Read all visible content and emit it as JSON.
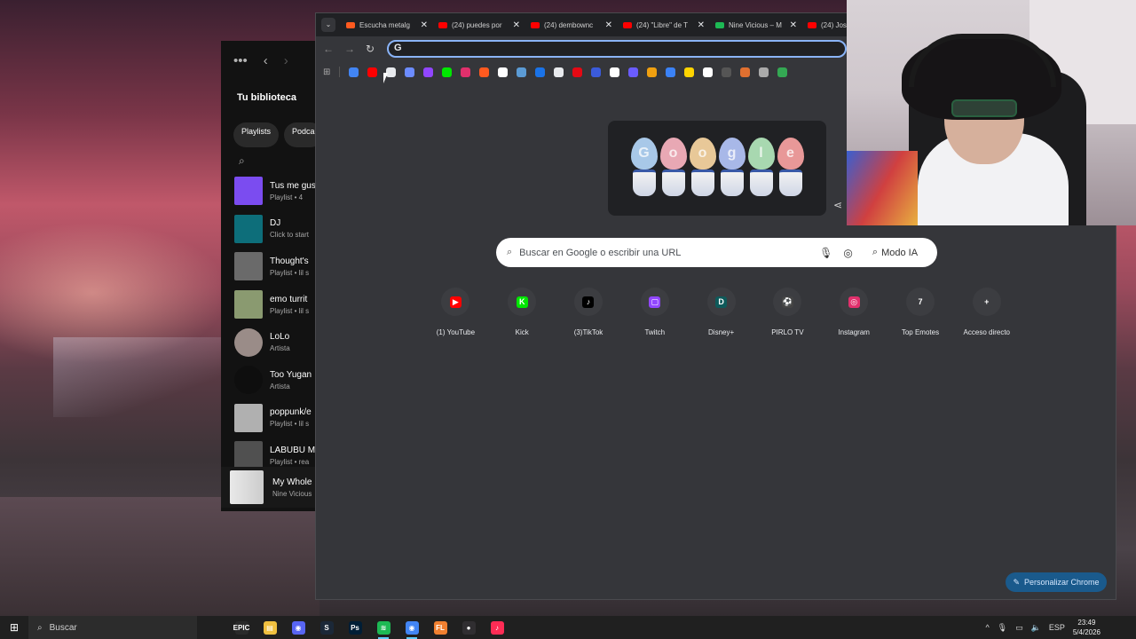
{
  "spotify": {
    "library_title": "Tu biblioteca",
    "chips": [
      "Playlists",
      "Podca"
    ],
    "items": [
      {
        "name": "Tus me gus",
        "sub": "Playlist • 4",
        "color": "#7b4cf0"
      },
      {
        "name": "DJ",
        "sub": "Click to start",
        "color": "#0d6e7a"
      },
      {
        "name": "Thought's",
        "sub": "Playlist • lil s",
        "color": "#6a6a6a"
      },
      {
        "name": "emo turrit",
        "sub": "Playlist • lil s",
        "color": "#8a9a70"
      },
      {
        "name": "LoLo",
        "sub": "Artista",
        "color": "#9a8c88"
      },
      {
        "name": "Too Yugan",
        "sub": "Artista",
        "color": "#0e0e0e"
      },
      {
        "name": "poppunk/e",
        "sub": "Playlist • lil s",
        "color": "#b0b0b0"
      },
      {
        "name": "LABUBU M",
        "sub": "Playlist • rea",
        "color": "#505050"
      }
    ],
    "now_playing": {
      "title": "My Whole H",
      "artist": "Nine Vicious"
    }
  },
  "chrome": {
    "tabs": [
      {
        "title": "Escucha metalg",
        "color": "#ff5a1f"
      },
      {
        "title": "(24) puedes por",
        "color": "#ff0000"
      },
      {
        "title": "(24) dembownc",
        "color": "#ff0000"
      },
      {
        "title": "(24) \"Libre\" de T",
        "color": "#ff0000"
      },
      {
        "title": "Nine Vicious – M",
        "color": "#1db954"
      },
      {
        "title": "(24) Jose",
        "color": "#ff0000"
      }
    ],
    "tab_close": "✕",
    "omnibox_value": "",
    "bookmarks": [
      "#4285f4",
      "#ff0000",
      "#e8eaed",
      "#6c8cff",
      "#9146ff",
      "#00e701",
      "#e1306c",
      "#ff5a1f",
      "#ffffff",
      "#5b9bd5",
      "#1a73e8",
      "#e8eaed",
      "#e50914",
      "#3b5bdb",
      "#ffffff",
      "#6a5cff",
      "#f0a010",
      "#3b82f6",
      "#ffd400",
      "#ffffff",
      "#555555",
      "#e07030",
      "#aaaaaa",
      "#34a853"
    ],
    "doodle_letters": [
      "G",
      "o",
      "o",
      "g",
      "l",
      "e"
    ],
    "doodle_colors": [
      "#a8c8e8",
      "#e8a8b4",
      "#e8c898",
      "#a8b8e8",
      "#a8d8b0",
      "#e89898"
    ],
    "search": {
      "placeholder": "Buscar en Google o escribir una URL",
      "mode_label": "Modo IA"
    },
    "shortcuts": [
      {
        "label": "(1) YouTube",
        "icon": "youtube-icon",
        "color": "#ff0000",
        "glyph": "▶"
      },
      {
        "label": "Kick",
        "icon": "kick-icon",
        "color": "#00e701",
        "glyph": "K"
      },
      {
        "label": "(3)TikTok",
        "icon": "tiktok-icon",
        "color": "#000000",
        "glyph": "♪"
      },
      {
        "label": "Twitch",
        "icon": "twitch-icon",
        "color": "#9146ff",
        "glyph": "▢"
      },
      {
        "label": "Disney+",
        "icon": "disney-icon",
        "color": "#0e5a5a",
        "glyph": "D"
      },
      {
        "label": "PIRLO TV",
        "icon": "pirlotv-icon",
        "color": "#444444",
        "glyph": "⚽"
      },
      {
        "label": "Instagram",
        "icon": "instagram-icon",
        "color": "#e1306c",
        "glyph": "◎"
      },
      {
        "label": "Top Emotes",
        "icon": "topemotes-icon",
        "color": "#3c3d41",
        "glyph": "7"
      },
      {
        "label": "Acceso directo",
        "icon": "add-icon",
        "color": "#3c3d41",
        "glyph": "+"
      }
    ],
    "customize_label": "Personalizar Chrome"
  },
  "taskbar": {
    "search_label": "Buscar",
    "apps": [
      {
        "name": "epic-games",
        "color": "#2a2a2a",
        "glyph": "EPIC"
      },
      {
        "name": "file-explorer",
        "color": "#f0c040",
        "glyph": "▤"
      },
      {
        "name": "discord",
        "color": "#5865f2",
        "glyph": "◉"
      },
      {
        "name": "steam",
        "color": "#1b2838",
        "glyph": "S"
      },
      {
        "name": "photoshop",
        "color": "#001e36",
        "glyph": "Ps"
      },
      {
        "name": "spotify",
        "color": "#1db954",
        "glyph": "≋"
      },
      {
        "name": "chrome",
        "color": "#4285f4",
        "glyph": "◉"
      },
      {
        "name": "fl-studio",
        "color": "#f08030",
        "glyph": "FL"
      },
      {
        "name": "obs",
        "color": "#302e31",
        "glyph": "●"
      },
      {
        "name": "tiktok-live",
        "color": "#fe2c55",
        "glyph": "♪"
      }
    ],
    "language": "ESP",
    "time": "23:49",
    "date": "5/4/2026"
  }
}
